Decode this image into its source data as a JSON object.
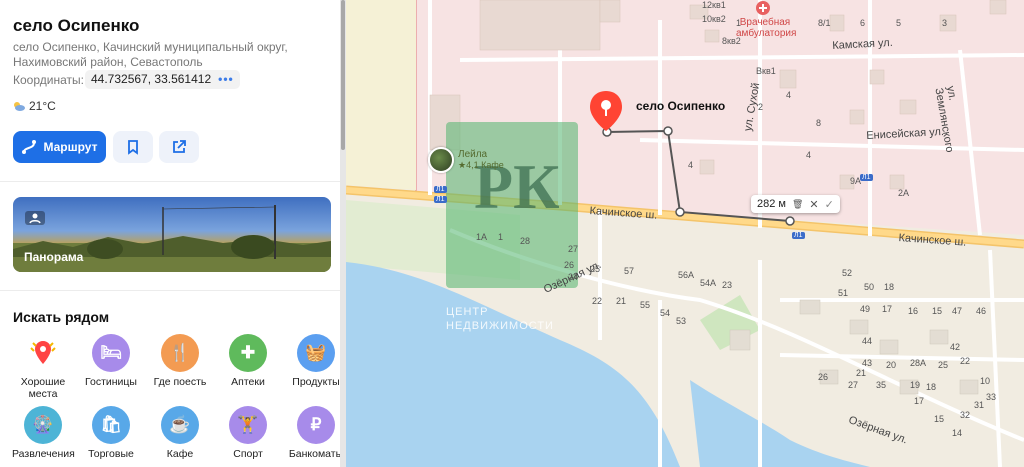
{
  "place": {
    "title": "село Осипенко",
    "address": "село Осипенко, Качинский муниципальный округ, Нахимовский район, Севастополь",
    "coords_label": "Координаты:",
    "coords_value": "44.732567, 33.561412",
    "coords_more": "•••",
    "weather": "21°C"
  },
  "actions": {
    "route_label": "Маршрут",
    "bookmark_icon": "bookmark-icon",
    "share_icon": "share-icon"
  },
  "panorama": {
    "label": "Панорама"
  },
  "nearby": {
    "title": "Искать рядом",
    "categories": [
      {
        "label": "Хорошие места",
        "color": "#ffffff",
        "icon": "good-places-icon"
      },
      {
        "label": "Гостиницы",
        "color": "#a78bea",
        "icon": "hotel-icon"
      },
      {
        "label": "Где поесть",
        "color": "#f39b52",
        "icon": "food-icon"
      },
      {
        "label": "Аптеки",
        "color": "#5fba5c",
        "icon": "pharmacy-icon"
      },
      {
        "label": "Продукты",
        "color": "#5b9ff0",
        "icon": "groceries-icon"
      },
      {
        "label": "Развлечения",
        "color": "#4db4d6",
        "icon": "entertainment-icon"
      },
      {
        "label": "Торговые",
        "color": "#58a8e8",
        "icon": "shopping-icon"
      },
      {
        "label": "Кафе",
        "color": "#58a8e8",
        "icon": "cafe-icon"
      },
      {
        "label": "Спорт",
        "color": "#a78bea",
        "icon": "sport-icon"
      },
      {
        "label": "Банкоматы",
        "color": "#a78bea",
        "icon": "atm-icon"
      }
    ]
  },
  "map": {
    "pin_label": "село Осипенко",
    "distance": "282 м",
    "clinic": "Врачебная амбулатория",
    "cafe_name": "Лейла",
    "cafe_rating": "★4,1 Кафе",
    "streets": {
      "kamskaya": "Камская ул.",
      "eniseyskaya": "Енисейская ул.",
      "zemlyanskogo": "ул. Землянского",
      "sukhoy": "ул. Сухой",
      "kachinskoe1": "Качинское ш.",
      "kachinskoe2": "Качинское ш.",
      "ozernaya1": "Озёрная ул.",
      "ozernaya2": "Озёрная ул."
    },
    "watermark_top": "ЦЕНТР",
    "watermark_bottom": "НЕДВИЖИМОСТИ",
    "watermark_logo": "РК",
    "road_badge": "Л1",
    "house_numbers": [
      "12кв1",
      "10кв2",
      "8кв2",
      "1",
      "8/1",
      "6",
      "5",
      "3",
      "Вкв1",
      "4",
      "2",
      "8",
      "4",
      "4",
      "9А",
      "2А",
      "1А",
      "1",
      "28",
      "27",
      "26",
      "24",
      "25",
      "57",
      "56А",
      "54А",
      "23",
      "22",
      "21",
      "55",
      "54",
      "53",
      "52",
      "51",
      "50",
      "18",
      "49",
      "17",
      "16",
      "15",
      "47",
      "46",
      "44",
      "43",
      "42",
      "22",
      "21",
      "20",
      "28А",
      "25",
      "26",
      "27",
      "35",
      "19",
      "18",
      "17",
      "15",
      "14",
      "10",
      "33",
      "31",
      "32"
    ]
  }
}
